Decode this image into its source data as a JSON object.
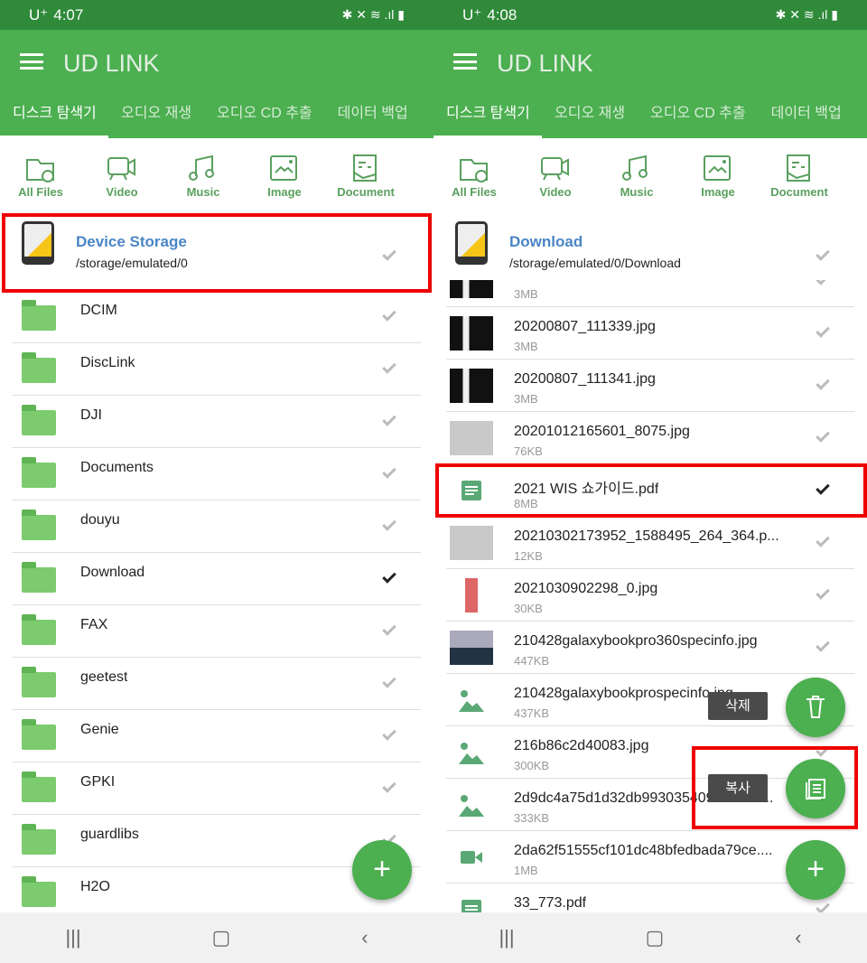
{
  "app_title": "UD LINK",
  "tabs": [
    "디스크 탐색기",
    "오디오 재생",
    "오디오 CD 추출",
    "데이터 백업"
  ],
  "categories": [
    "All Files",
    "Video",
    "Music",
    "Image",
    "Document"
  ],
  "accent": "#4caf50",
  "left": {
    "status_time": "4:07",
    "carrier": "U⁺",
    "header": {
      "name": "Device Storage",
      "path": "/storage/emulated/0"
    },
    "folders": [
      {
        "name": "DCIM",
        "checked": false
      },
      {
        "name": "DiscLink",
        "checked": false
      },
      {
        "name": "DJI",
        "checked": false
      },
      {
        "name": "Documents",
        "checked": false
      },
      {
        "name": "douyu",
        "checked": false
      },
      {
        "name": "Download",
        "checked": true
      },
      {
        "name": "FAX",
        "checked": false
      },
      {
        "name": "geetest",
        "checked": false
      },
      {
        "name": "Genie",
        "checked": false
      },
      {
        "name": "GPKI",
        "checked": false
      },
      {
        "name": "guardlibs",
        "checked": false
      },
      {
        "name": "H2O",
        "checked": false
      }
    ],
    "fab": "+"
  },
  "right": {
    "status_time": "4:08",
    "carrier": "U⁺",
    "header": {
      "name": "Download",
      "path": "/storage/emulated/0/Download"
    },
    "files": [
      {
        "name": "",
        "size": "3MB",
        "icon": "photo-dark",
        "checked": false
      },
      {
        "name": "20200807_111339.jpg",
        "size": "3MB",
        "icon": "photo-dark",
        "checked": false
      },
      {
        "name": "20200807_111341.jpg",
        "size": "3MB",
        "icon": "photo-dark",
        "checked": false
      },
      {
        "name": "20201012165601_8075.jpg",
        "size": "76KB",
        "icon": "photo-light",
        "checked": false
      },
      {
        "name": "2021 WIS 쇼가이드.pdf",
        "size": "8MB",
        "icon": "document",
        "checked": true
      },
      {
        "name": "20210302173952_1588495_264_364.p...",
        "size": "12KB",
        "icon": "photo-light",
        "checked": false
      },
      {
        "name": "2021030902298_0.jpg",
        "size": "30KB",
        "icon": "photo-red",
        "checked": false
      },
      {
        "name": "210428galaxybookpro360specinfo.jpg",
        "size": "447KB",
        "icon": "photo-navy",
        "checked": false
      },
      {
        "name": "210428galaxybookprospecinfo.jpg",
        "size": "437KB",
        "icon": "image",
        "checked": false
      },
      {
        "name": "216b86c2d40083.jpg",
        "size": "300KB",
        "icon": "image",
        "checked": false
      },
      {
        "name": "2d9dc4a75d1d32db99303540936c3ab...",
        "size": "333KB",
        "icon": "image",
        "checked": false
      },
      {
        "name": "2da62f51555cf101dc48bfedbada79ce....",
        "size": "1MB",
        "icon": "video",
        "checked": false
      },
      {
        "name": "33_773.pdf",
        "size": "",
        "icon": "document",
        "checked": false
      }
    ],
    "delete_label": "삭제",
    "copy_label": "복사",
    "fab": "+"
  }
}
